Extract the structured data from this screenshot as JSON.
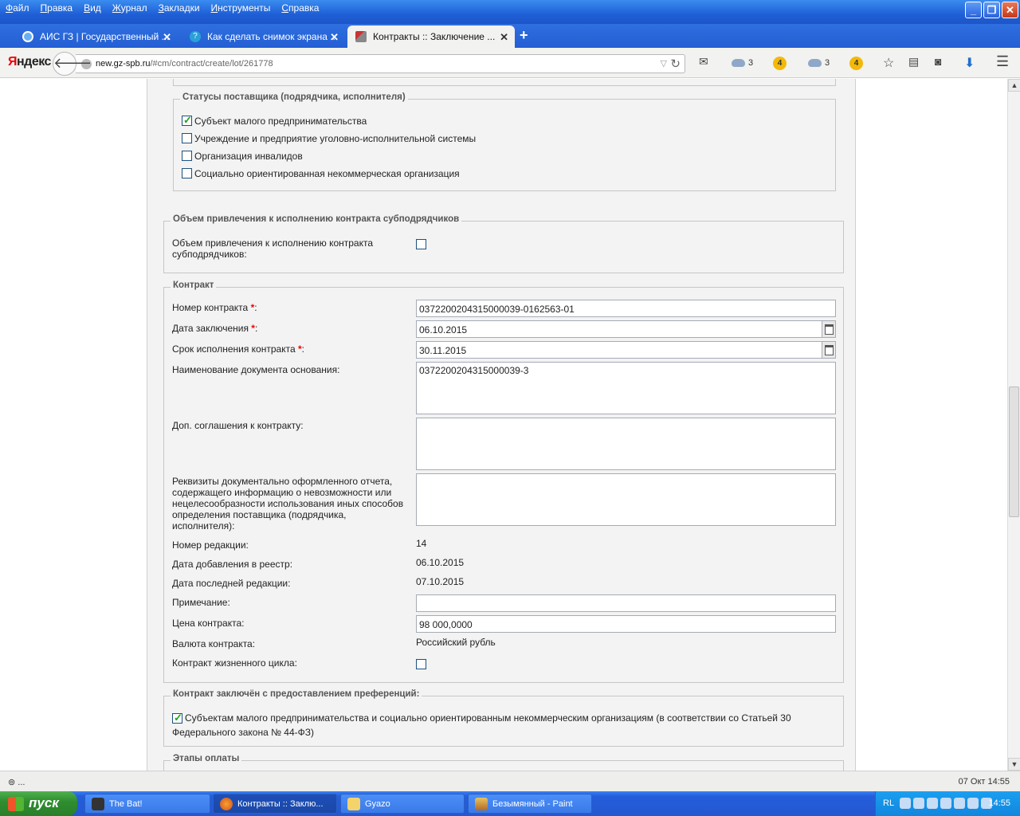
{
  "menu": [
    "Файл",
    "Правка",
    "Вид",
    "Журнал",
    "Закладки",
    "Инструменты",
    "Справка"
  ],
  "tabs": [
    {
      "label": "АИС ГЗ | Государственный ...",
      "icon": "globe-icon",
      "active": false
    },
    {
      "label": "Как сделать снимок экрана ...",
      "icon": "help-icon",
      "active": false
    },
    {
      "label": "Контракты :: Заключение ...",
      "icon": "tools-icon",
      "active": true
    }
  ],
  "toolbar": {
    "brand_first": "Я",
    "brand_rest": "ндекс",
    "url_host": "new.gz-spb.ru",
    "url_path": "/#cm/contract/create/lot/261778",
    "cloud1_count": "3",
    "badge1": "4",
    "cloud2_count": "3",
    "badge2": "4"
  },
  "form": {
    "supplier_status": {
      "legend": "Статусы поставщика (подрядчика, исполнителя)",
      "options": [
        {
          "label": "Субъект малого предпринимательства",
          "checked": true
        },
        {
          "label": "Учреждение и предприятие уголовно-исполнительной системы",
          "checked": false
        },
        {
          "label": "Организация инвалидов",
          "checked": false
        },
        {
          "label": "Социально ориентированная некоммерческая организация",
          "checked": false
        }
      ]
    },
    "subcontract": {
      "legend": "Объем привлечения к исполнению контракта субподрядчиков",
      "label_line1": "Объем привлечения к исполнению контракта",
      "label_line2": "субподрядчиков:",
      "checked": false
    },
    "contract": {
      "legend": "Контракт",
      "number_label": "Номер контракта ",
      "number_value": "0372200204315000039-0162563-01",
      "date_label": "Дата заключения ",
      "date_value": "06.10.2015",
      "term_label": "Срок исполнения контракта ",
      "term_value": "30.11.2015",
      "basis_label": "Наименование документа основания:",
      "basis_value": "0372200204315000039-3",
      "addons_label": "Доп. соглашения к контракту:",
      "addons_value": "",
      "report_label_lines": [
        "Реквизиты документально оформленного отчета,",
        "содержащего информацию о невозможности или",
        "нецелесообразности использования иных способов",
        "определения поставщика (подрядчика,",
        "исполнителя):"
      ],
      "report_value": "",
      "revision_label": "Номер редакции:",
      "revision_value": "14",
      "added_label": "Дата добавления в реестр:",
      "added_value": "06.10.2015",
      "last_edit_label": "Дата последней редакции:",
      "last_edit_value": "07.10.2015",
      "note_label": "Примечание:",
      "note_value": "",
      "price_label": "Цена контракта:",
      "price_value": "98 000,0000",
      "currency_label": "Валюта контракта:",
      "currency_value": "Российский рубль",
      "lifecycle_label": "Контракт жизненного цикла:",
      "lifecycle_checked": false,
      "required_mark": "*",
      "colon": ":"
    },
    "preferences": {
      "legend": "Контракт заключён с предоставлением преференций:",
      "line1": "Субъектам малого предпринимательства и социально ориентированным некоммерческим организациям (в соответствии со Статьей 30",
      "line2": "Федерального закона № 44-ФЗ)",
      "checked": true
    },
    "payments": {
      "legend": "Этапы оплаты"
    }
  },
  "statusbar": {
    "left": "...",
    "datetime": "07 Окт 14:55"
  },
  "taskbar": {
    "start": "пуск",
    "tasks": [
      {
        "label": "The Bat!",
        "active": false
      },
      {
        "label": "Контракты :: Заклю...",
        "active": true
      },
      {
        "label": "Gyazo",
        "active": false
      },
      {
        "label": "Безымянный - Paint",
        "active": false
      }
    ],
    "lang": "RL",
    "clock": "14:55"
  }
}
